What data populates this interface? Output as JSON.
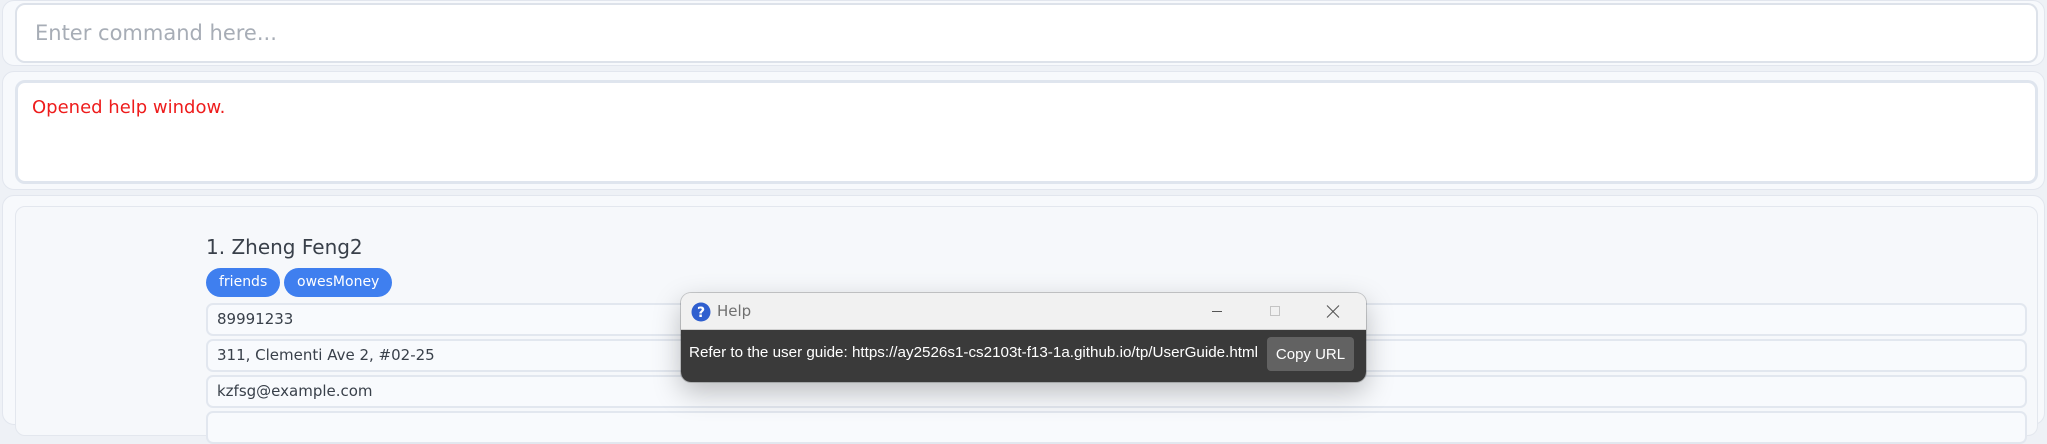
{
  "command_box": {
    "placeholder": "Enter command here...",
    "value": ""
  },
  "result_display": {
    "text": "Opened help window."
  },
  "person_list": {
    "persons": [
      {
        "index_name": "1. Zheng Feng2",
        "tags": [
          "friends",
          "owesMoney"
        ],
        "fields": [
          "89991233",
          "311, Clementi Ave 2, #02-25",
          "kzfsg@example.com",
          ""
        ]
      }
    ]
  },
  "help_window": {
    "title": "Help",
    "message": "Refer to the user guide: https://ay2526s1-cs2103t-f13-1a.github.io/tp/UserGuide.html",
    "copy_button_label": "Copy URL",
    "icons": {
      "app": "help-question-icon",
      "minimize": "minimize-icon",
      "maximize": "maximize-icon",
      "close": "close-icon"
    }
  },
  "colors": {
    "result_text": "#ee1c1c",
    "tag_background": "#3f7fef",
    "dialog_body": "#3a3a3a",
    "copy_button": "#626262",
    "help_icon": "#2f5fcf"
  }
}
